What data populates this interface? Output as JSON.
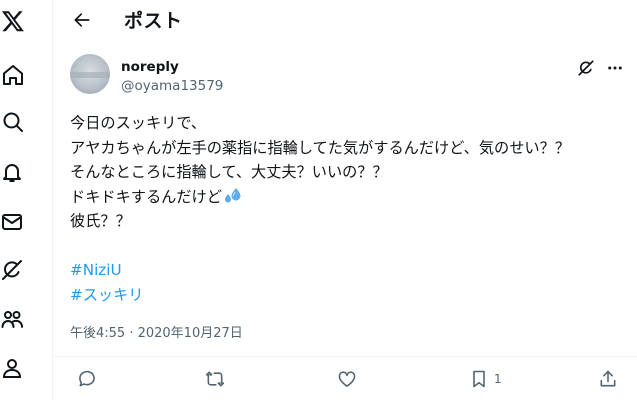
{
  "sidebar": {
    "items": [
      {
        "icon": "x-logo-icon"
      },
      {
        "icon": "home-icon"
      },
      {
        "icon": "search-icon"
      },
      {
        "icon": "notifications-icon"
      },
      {
        "icon": "messages-icon"
      },
      {
        "icon": "grok-icon"
      },
      {
        "icon": "communities-icon"
      },
      {
        "icon": "profile-icon"
      }
    ]
  },
  "header": {
    "title": "ポスト"
  },
  "post": {
    "display_name": "noreply",
    "username": "@oyama13579",
    "lines": [
      "今日のスッキリで、",
      "アヤカちゃんが左手の薬指に指輪してた気がするんだけど、気のせい？？",
      "そんなところに指輪して、大丈夫？いいの？？",
      "ドキドキするんだけど",
      "彼氏？？"
    ],
    "emoji": "sweat-droplets-icon",
    "hashtags": [
      "#NiziU",
      "#スッキリ"
    ],
    "timestamp": "午後4:55 · 2020年10月27日",
    "bookmark_count": "1"
  },
  "colors": {
    "text": "#0f1419",
    "secondary": "#536471",
    "accent": "#1d9bf0",
    "divider": "#eff3f4"
  }
}
